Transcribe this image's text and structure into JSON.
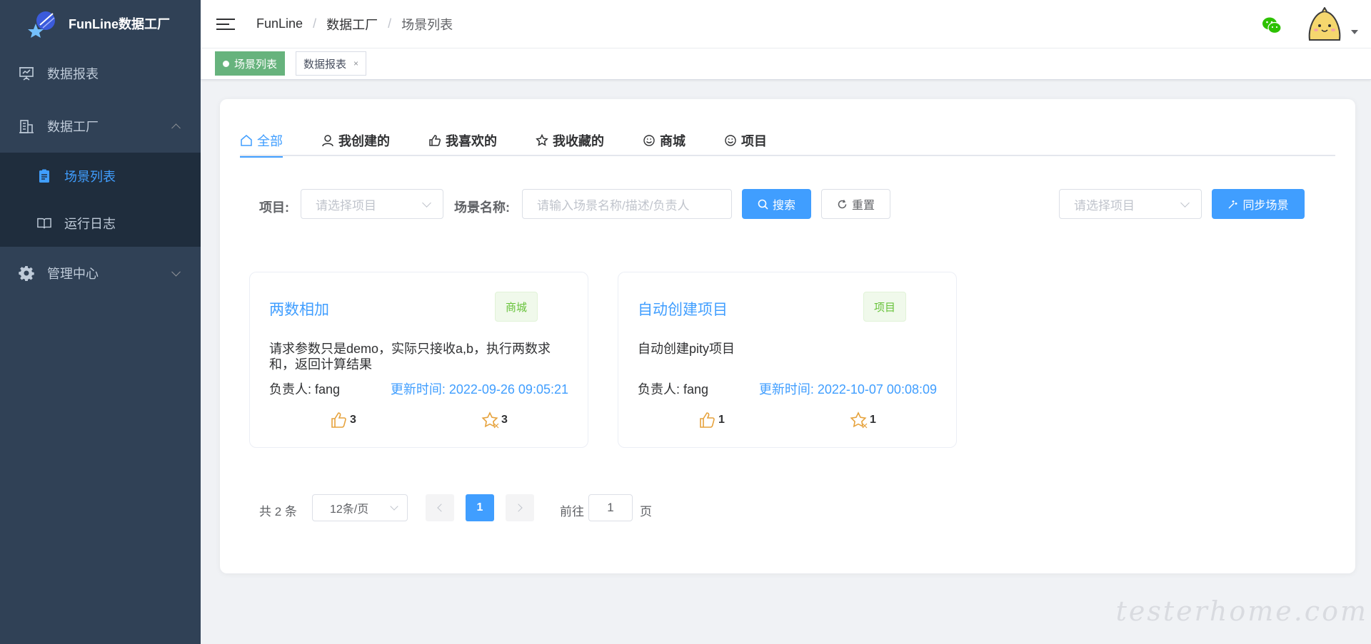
{
  "brand": {
    "title": "FunLine数据工厂"
  },
  "sidebar": {
    "items": [
      {
        "label": "数据报表",
        "icon": "presentation-board-icon"
      },
      {
        "label": "数据工厂",
        "icon": "building-icon",
        "expanded": true,
        "children": [
          {
            "label": "场景列表",
            "icon": "clipboard-icon",
            "active": true
          },
          {
            "label": "运行日志",
            "icon": "book-icon"
          }
        ]
      },
      {
        "label": "管理中心",
        "icon": "gear-icon",
        "expanded": false
      }
    ]
  },
  "header": {
    "breadcrumb": [
      "FunLine",
      "数据工厂",
      "场景列表"
    ],
    "separator": "/"
  },
  "tagsview": {
    "tags": [
      {
        "label": "场景列表",
        "active": true
      },
      {
        "label": "数据报表",
        "close": "×"
      }
    ]
  },
  "tabs": [
    {
      "label": "全部",
      "icon": "home-icon",
      "active": true
    },
    {
      "label": "我创建的",
      "icon": "user-icon"
    },
    {
      "label": "我喜欢的",
      "icon": "thumb-up-icon"
    },
    {
      "label": "我收藏的",
      "icon": "star-icon"
    },
    {
      "label": "商城",
      "icon": "smile-icon"
    },
    {
      "label": "项目",
      "icon": "smile-icon"
    }
  ],
  "filters": {
    "project_label": "项目:",
    "project_placeholder": "请选择项目",
    "scene_label": "场景名称:",
    "scene_placeholder": "请输入场景名称/描述/负责人",
    "search_label": "搜索",
    "reset_label": "重置",
    "sync_project_placeholder": "请选择项目",
    "sync_label": "同步场景"
  },
  "scenes": [
    {
      "name": "两数相加",
      "tag": "商城",
      "description": "请求参数只是demo，实际只接收a,b，执行两数求和，返回计算结果",
      "owner": "负责人: fang",
      "updated": "更新时间: 2022-09-26 09:05:21",
      "likes": "3",
      "favorites": "3"
    },
    {
      "name": "自动创建项目",
      "tag": "项目",
      "description": "自动创建pity项目",
      "owner": "负责人: fang",
      "updated": "更新时间: 2022-10-07 00:08:09",
      "likes": "1",
      "favorites": "1"
    }
  ],
  "pagination": {
    "total": "共 2 条",
    "page_size": "12条/页",
    "current": "1",
    "goto_label": "前往",
    "goto_value": "1",
    "goto_unit": "页"
  },
  "watermark": "testerhome.com",
  "colors": {
    "sidebar_bg": "#304156",
    "accent": "#409eff",
    "active_tag": "#67b37d",
    "icon_orange": "#e6a23c"
  }
}
